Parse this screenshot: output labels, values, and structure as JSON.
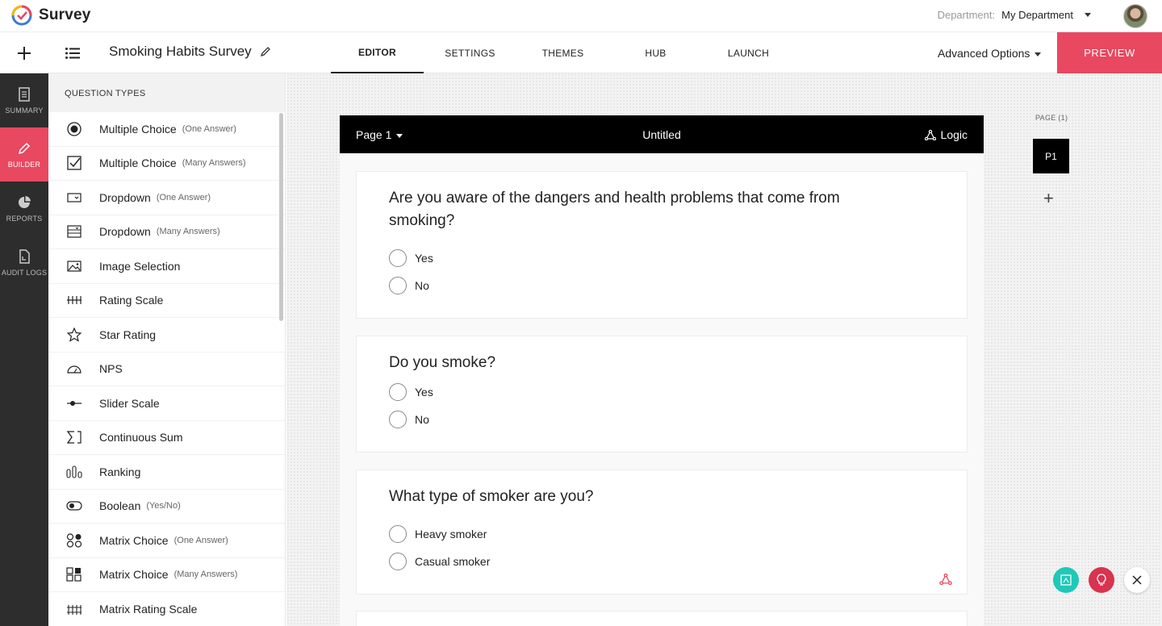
{
  "app": {
    "name": "Survey"
  },
  "department": {
    "label": "Department:",
    "value": "My Department"
  },
  "survey": {
    "title": "Smoking Habits Survey"
  },
  "tabs": [
    {
      "label": "EDITOR",
      "active": true
    },
    {
      "label": "SETTINGS"
    },
    {
      "label": "THEMES"
    },
    {
      "label": "HUB"
    },
    {
      "label": "LAUNCH"
    }
  ],
  "advanced_options": "Advanced Options",
  "preview_label": "PREVIEW",
  "leftnav": [
    {
      "label": "SUMMARY",
      "icon": "summary-icon"
    },
    {
      "label": "BUILDER",
      "icon": "pencil-icon",
      "active": true
    },
    {
      "label": "REPORTS",
      "icon": "pie-chart-icon"
    },
    {
      "label": "AUDIT LOGS",
      "icon": "audit-log-icon"
    }
  ],
  "question_types": {
    "heading": "QUESTION TYPES",
    "items": [
      {
        "label": "Multiple Choice",
        "sub": "(One Answer)",
        "icon": "radio-icon"
      },
      {
        "label": "Multiple Choice",
        "sub": "(Many Answers)",
        "icon": "checkbox-icon"
      },
      {
        "label": "Dropdown",
        "sub": "(One Answer)",
        "icon": "dropdown-icon"
      },
      {
        "label": "Dropdown",
        "sub": "(Many Answers)",
        "icon": "multi-dropdown-icon"
      },
      {
        "label": "Image Selection",
        "sub": "",
        "icon": "image-icon"
      },
      {
        "label": "Rating Scale",
        "sub": "",
        "icon": "rating-scale-icon"
      },
      {
        "label": "Star Rating",
        "sub": "",
        "icon": "star-icon"
      },
      {
        "label": "NPS",
        "sub": "",
        "icon": "gauge-icon"
      },
      {
        "label": "Slider Scale",
        "sub": "",
        "icon": "slider-icon"
      },
      {
        "label": "Continuous Sum",
        "sub": "",
        "icon": "sum-icon"
      },
      {
        "label": "Ranking",
        "sub": "",
        "icon": "ranking-icon"
      },
      {
        "label": "Boolean",
        "sub": "(Yes/No)",
        "icon": "toggle-icon"
      },
      {
        "label": "Matrix Choice",
        "sub": "(One Answer)",
        "icon": "matrix-radio-icon"
      },
      {
        "label": "Matrix Choice",
        "sub": "(Many Answers)",
        "icon": "matrix-checkbox-icon"
      },
      {
        "label": "Matrix Rating Scale",
        "sub": "",
        "icon": "matrix-rating-icon"
      }
    ]
  },
  "page": {
    "selector": "Page 1",
    "title": "Untitled",
    "logic_label": "Logic",
    "questions": [
      {
        "text": "Are you aware of the dangers and health problems that come from smoking?",
        "options": [
          "Yes",
          "No"
        ]
      },
      {
        "text": "Do you smoke?",
        "options": [
          "Yes",
          "No"
        ]
      },
      {
        "text": "What type of smoker are you?",
        "options": [
          "Heavy smoker",
          "Casual smoker"
        ]
      }
    ]
  },
  "pages_panel": {
    "label": "PAGE (1)",
    "pages": [
      "P1"
    ],
    "add": "+"
  },
  "colors": {
    "accent": "#e84860",
    "teal": "#1fc8b8",
    "dark": "#2d2d2d"
  }
}
